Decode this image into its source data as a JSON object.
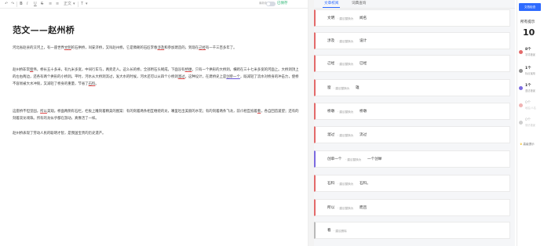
{
  "toolbar": {
    "undo": "↶",
    "redo": "↷",
    "bold": "B",
    "italic": "I",
    "underline": "U",
    "strike": "S",
    "list1": "≡",
    "list2": "≡",
    "text_style": "正文",
    "text_style_caret": "▾",
    "text_color": "T",
    "text_color_caret": "▾",
    "word_count": "最新版本",
    "saved": "已保存"
  },
  "document": {
    "title": "范文——赵州桥",
    "p1_segments": [
      {
        "t": "河北省赵县的洨河上，有一座世界",
        "c": ""
      },
      {
        "t": "文明",
        "c": "err"
      },
      {
        "t": "的石拱桥，叫安济桥，又叫赵州桥。它是隋朝的石匠李春",
        "c": ""
      },
      {
        "t": "涉及",
        "c": "err"
      },
      {
        "t": "和参加建造的，到现在",
        "c": ""
      },
      {
        "t": "己经",
        "c": "err"
      },
      {
        "t": "有一千三百多年了。",
        "c": ""
      }
    ],
    "p2_segments": [
      {
        "t": "赵州桥非常",
        "c": ""
      },
      {
        "t": "窗",
        "c": "err"
      },
      {
        "t": "伟，桥长五十多米，有九米多宽，中间行车马，两旁走人。这么长的桥，全部用石头砌成，下面没有",
        "c": ""
      },
      {
        "t": "桥墩",
        "c": "err"
      },
      {
        "t": "，只有一个拱形的大桥洞，横跨在三十七米多宽的河面上。大桥洞顶上的左右两边，还各有两个拱形的小桥洞。平时，河水从大桥洞流过，发大水的时候，河水还可以从四个小桥洞",
        "c": ""
      },
      {
        "t": "溜过",
        "c": "err"
      },
      {
        "t": "。这种设计，在建桥史上是",
        "c": ""
      },
      {
        "t": "创单一个",
        "c": "errb"
      },
      {
        "t": "，既减轻了流水对桥身的冲击力，使桥不容易被大水冲毁，又减轻了桥身的重量，节省了",
        "c": ""
      },
      {
        "t": "石料",
        "c": "err"
      },
      {
        "t": "。",
        "c": ""
      }
    ],
    "p3_segments": [
      {
        "t": "这座桥不但坚固，",
        "c": ""
      },
      {
        "t": "所以",
        "c": "err"
      },
      {
        "t": "美观。桥面两侧有石栏，栏板上雕刻着精美的图案：有的刻着两条相互缠绕的龙，嘴里吐出美丽的水花；有的刻着两条飞龙，前爪相互抵着",
        "c": ""
      },
      {
        "t": "看",
        "c": "err"
      },
      {
        "t": "，各自回首遥望；还有的刻着双龙戏珠。所有的龙似乎都在游动，真像活了一样。",
        "c": ""
      }
    ],
    "p4": "赵州桥表现了劳动人民的聪明才智，是我国宝贵的历史遗产。"
  },
  "panel": {
    "tabs": [
      "文章校阅",
      "词典查询"
    ],
    "hint_label": "· 建议替换为",
    "delete_label": "· 建议删除",
    "cards": [
      {
        "orig": "文明",
        "sug": "闻名"
      },
      {
        "orig": "涉及",
        "sug": "设计"
      },
      {
        "orig": "己经",
        "sug": "已经"
      },
      {
        "orig": "窗",
        "sug": "雄"
      },
      {
        "orig": "桥墩",
        "sug": "桥墩"
      },
      {
        "orig": "溜过",
        "sug": "流过"
      },
      {
        "orig": "创单一个",
        "sug": "一个创举"
      },
      {
        "orig": "石料",
        "sug": "石料。"
      },
      {
        "orig": "所以",
        "sug": "而且"
      },
      {
        "orig": "看",
        "sug": ""
      }
    ]
  },
  "stats": {
    "check_button": "文档检查",
    "label": "所有提示",
    "total": "10",
    "categories": [
      {
        "count": "8个",
        "name": "字词错误",
        "color": "#e36a6a"
      },
      {
        "count": "1个",
        "name": "标点误用",
        "color": "#8f8f8f"
      },
      {
        "count": "1个",
        "name": "语法错误",
        "color": "#7b6ae0"
      },
      {
        "count": "0个",
        "name": "地名/人名",
        "color": "#f0b3b3"
      },
      {
        "count": "0个",
        "name": "常识错误",
        "color": "#cfcfcf"
      }
    ],
    "high_quality": "高级提示"
  }
}
